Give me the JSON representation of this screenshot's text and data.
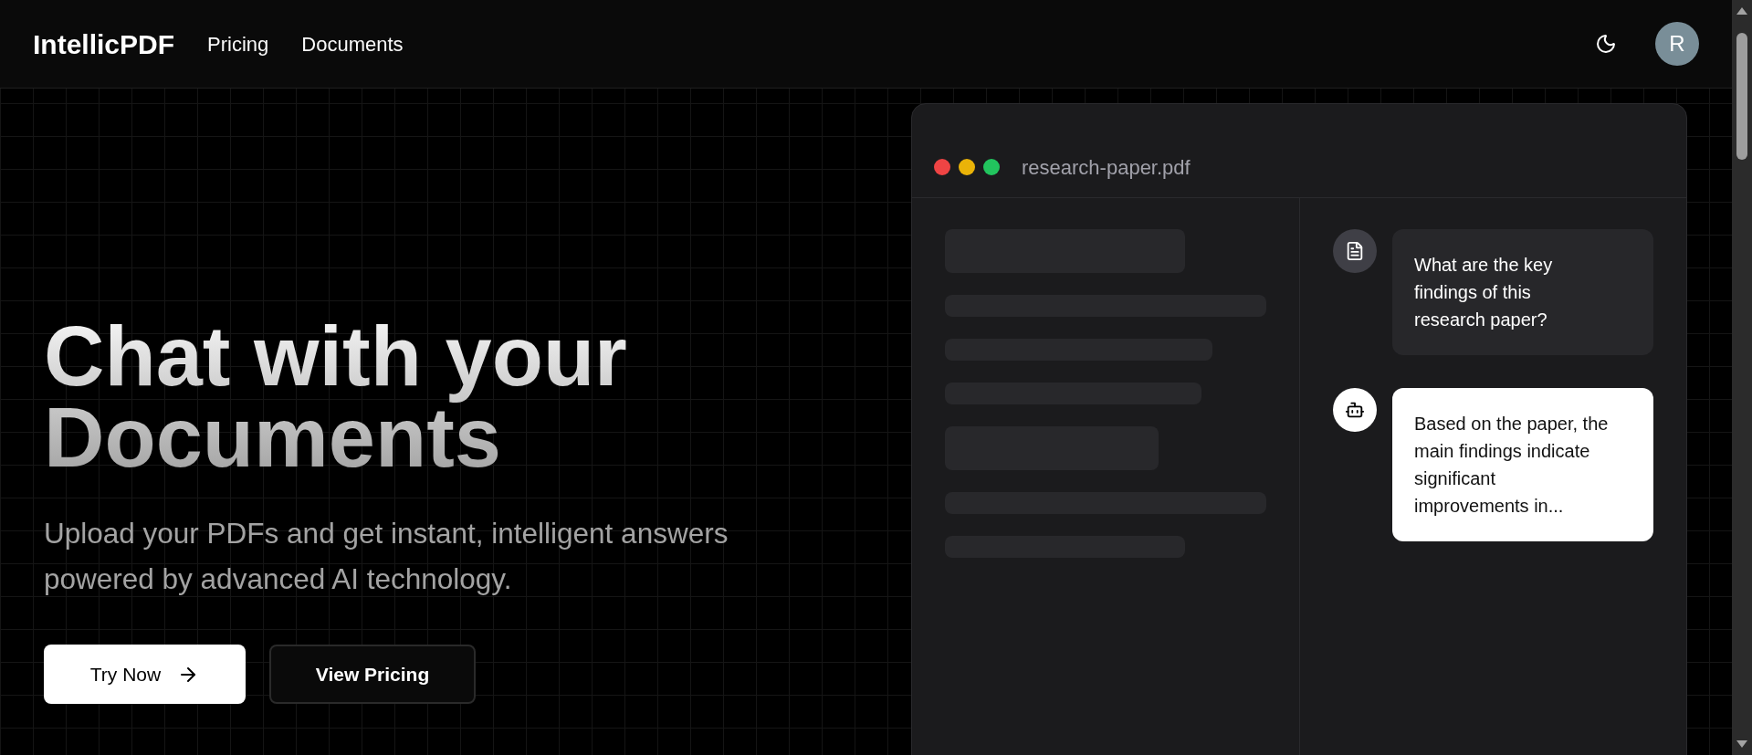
{
  "header": {
    "logo": "IntellicPDF",
    "nav": [
      "Pricing",
      "Documents"
    ],
    "avatar": "R"
  },
  "hero": {
    "title": "Chat with your Documents",
    "subtitle": "Upload your PDFs and get instant, intelligent answers powered by advanced AI technology.",
    "buttons": [
      {
        "label": "Try Now",
        "kind": "primary"
      },
      {
        "label": "View Pricing",
        "kind": "secondary"
      }
    ]
  },
  "preview": {
    "file_name": "research-paper.pdf",
    "window_dots": [
      {
        "color": "#ef4444"
      },
      {
        "color": "#eab308"
      },
      {
        "color": "#22c55e"
      }
    ],
    "messages": [
      {
        "kind": "user",
        "text": "What are the key\nfindings of this\nresearch paper?"
      },
      {
        "kind": "bot",
        "text": "Based on the paper, the\nmain findings indicate\nsignificant\nimprovements in..."
      }
    ]
  }
}
